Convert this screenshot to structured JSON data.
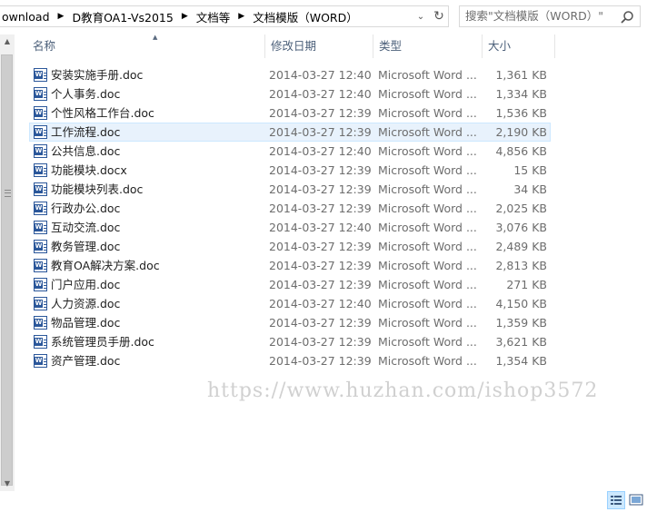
{
  "address_bar": {
    "crumbs": [
      "ownload",
      "D教育OA1-Vs2015",
      "文档等",
      "文档模版（WORD）"
    ]
  },
  "search": {
    "placeholder": "搜索\"文档模版（WORD）\""
  },
  "columns": {
    "name": "名称",
    "date": "修改日期",
    "type": "类型",
    "size": "大小"
  },
  "files": [
    {
      "name": "安装实施手册.doc",
      "date": "2014-03-27 12:40",
      "type": "Microsoft Word ...",
      "size": "1,361 KB"
    },
    {
      "name": "个人事务.doc",
      "date": "2014-03-27 12:40",
      "type": "Microsoft Word ...",
      "size": "1,334 KB"
    },
    {
      "name": "个性风格工作台.doc",
      "date": "2014-03-27 12:39",
      "type": "Microsoft Word ...",
      "size": "1,536 KB"
    },
    {
      "name": "工作流程.doc",
      "date": "2014-03-27 12:39",
      "type": "Microsoft Word ...",
      "size": "2,190 KB",
      "selected": true
    },
    {
      "name": "公共信息.doc",
      "date": "2014-03-27 12:40",
      "type": "Microsoft Word ...",
      "size": "4,856 KB"
    },
    {
      "name": "功能模块.docx",
      "date": "2014-03-27 12:39",
      "type": "Microsoft Word ...",
      "size": "15 KB"
    },
    {
      "name": "功能模块列表.doc",
      "date": "2014-03-27 12:39",
      "type": "Microsoft Word ...",
      "size": "34 KB"
    },
    {
      "name": "行政办公.doc",
      "date": "2014-03-27 12:39",
      "type": "Microsoft Word ...",
      "size": "2,025 KB"
    },
    {
      "name": "互动交流.doc",
      "date": "2014-03-27 12:40",
      "type": "Microsoft Word ...",
      "size": "3,076 KB"
    },
    {
      "name": "教务管理.doc",
      "date": "2014-03-27 12:39",
      "type": "Microsoft Word ...",
      "size": "2,489 KB"
    },
    {
      "name": "教育OA解决方案.doc",
      "date": "2014-03-27 12:39",
      "type": "Microsoft Word ...",
      "size": "2,813 KB"
    },
    {
      "name": "门户应用.doc",
      "date": "2014-03-27 12:39",
      "type": "Microsoft Word ...",
      "size": "271 KB"
    },
    {
      "name": "人力资源.doc",
      "date": "2014-03-27 12:40",
      "type": "Microsoft Word ...",
      "size": "4,150 KB"
    },
    {
      "name": "物品管理.doc",
      "date": "2014-03-27 12:39",
      "type": "Microsoft Word ...",
      "size": "1,359 KB"
    },
    {
      "name": "系统管理员手册.doc",
      "date": "2014-03-27 12:39",
      "type": "Microsoft Word ...",
      "size": "3,621 KB"
    },
    {
      "name": "资产管理.doc",
      "date": "2014-03-27 12:39",
      "type": "Microsoft Word ...",
      "size": "1,354 KB"
    }
  ],
  "watermark": "https://www.huzhan.com/ishop3572",
  "icons": {
    "file": "word-doc-icon",
    "search": "search-icon",
    "refresh": "refresh-icon",
    "dropdown": "chevron-down-icon",
    "breadcrumb_separator": "chevron-right-icon",
    "details_view": "details-view-icon",
    "tiles_view": "large-icons-view-icon"
  },
  "colors": {
    "selection": "#e8f2fc",
    "selection_border": "#cde8ff",
    "header_text": "#4c607a",
    "word_blue": "#2b579a"
  }
}
